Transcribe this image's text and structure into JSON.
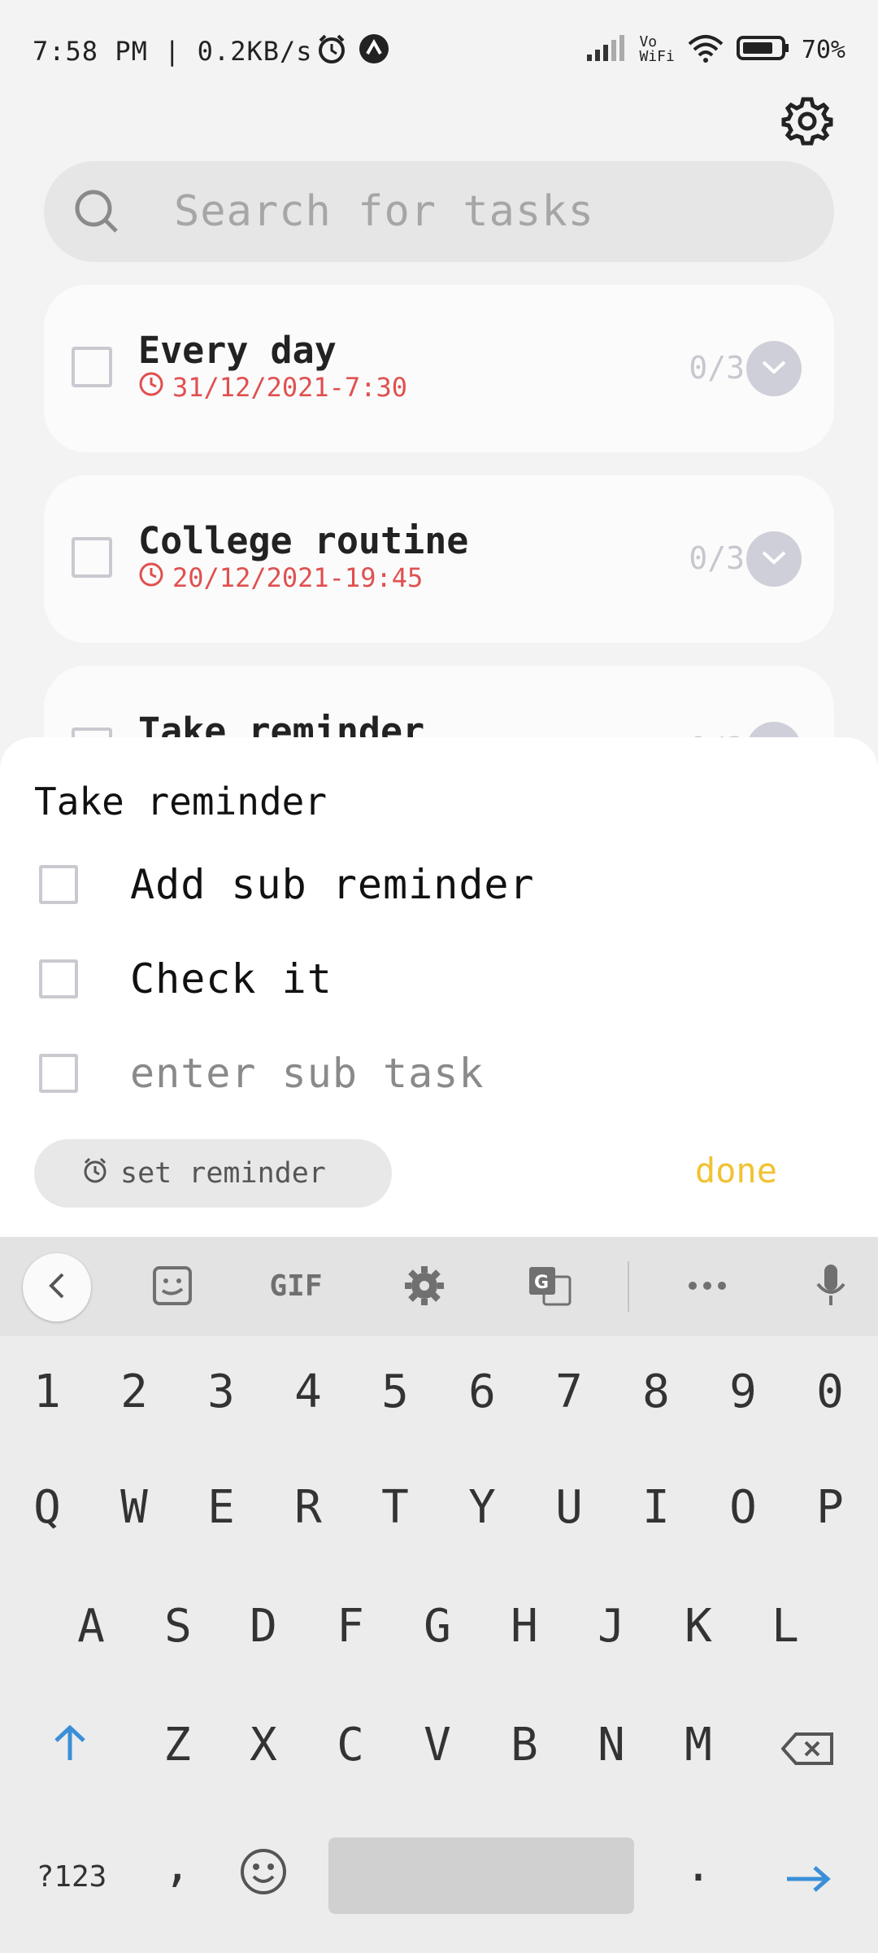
{
  "status_bar": {
    "time": "7:58 PM | 0.2KB/s",
    "signal_label_top": "Vo",
    "signal_label_bottom": "WiFi",
    "battery": "70%"
  },
  "search": {
    "placeholder": "Search for tasks"
  },
  "tasks": [
    {
      "title": "Every day",
      "date": "31/12/2021-7:30",
      "count": "0/3"
    },
    {
      "title": "College routine",
      "date": "20/12/2021-19:45",
      "count": "0/3"
    },
    {
      "title": "Take reminder",
      "date": "",
      "count": "0/3"
    }
  ],
  "sheet": {
    "title": "Take reminder",
    "sub_tasks": [
      "Add sub reminder",
      "Check it"
    ],
    "input_placeholder": "enter sub task",
    "set_reminder_label": "set reminder",
    "done_label": "done"
  },
  "keyboard": {
    "toolbar": {
      "gif_label": "GIF"
    },
    "row_numbers": [
      "1",
      "2",
      "3",
      "4",
      "5",
      "6",
      "7",
      "8",
      "9",
      "0"
    ],
    "row_1": [
      "Q",
      "W",
      "E",
      "R",
      "T",
      "Y",
      "U",
      "I",
      "O",
      "P"
    ],
    "row_2": [
      "A",
      "S",
      "D",
      "F",
      "G",
      "H",
      "J",
      "K",
      "L"
    ],
    "row_3": [
      "Z",
      "X",
      "C",
      "V",
      "B",
      "N",
      "M"
    ],
    "symbols_label": "?123",
    "comma": ",",
    "period": "."
  },
  "colors": {
    "accent_done": "#f1c232",
    "date_red": "#e05050",
    "keyboard_blue": "#3a8fd8"
  }
}
